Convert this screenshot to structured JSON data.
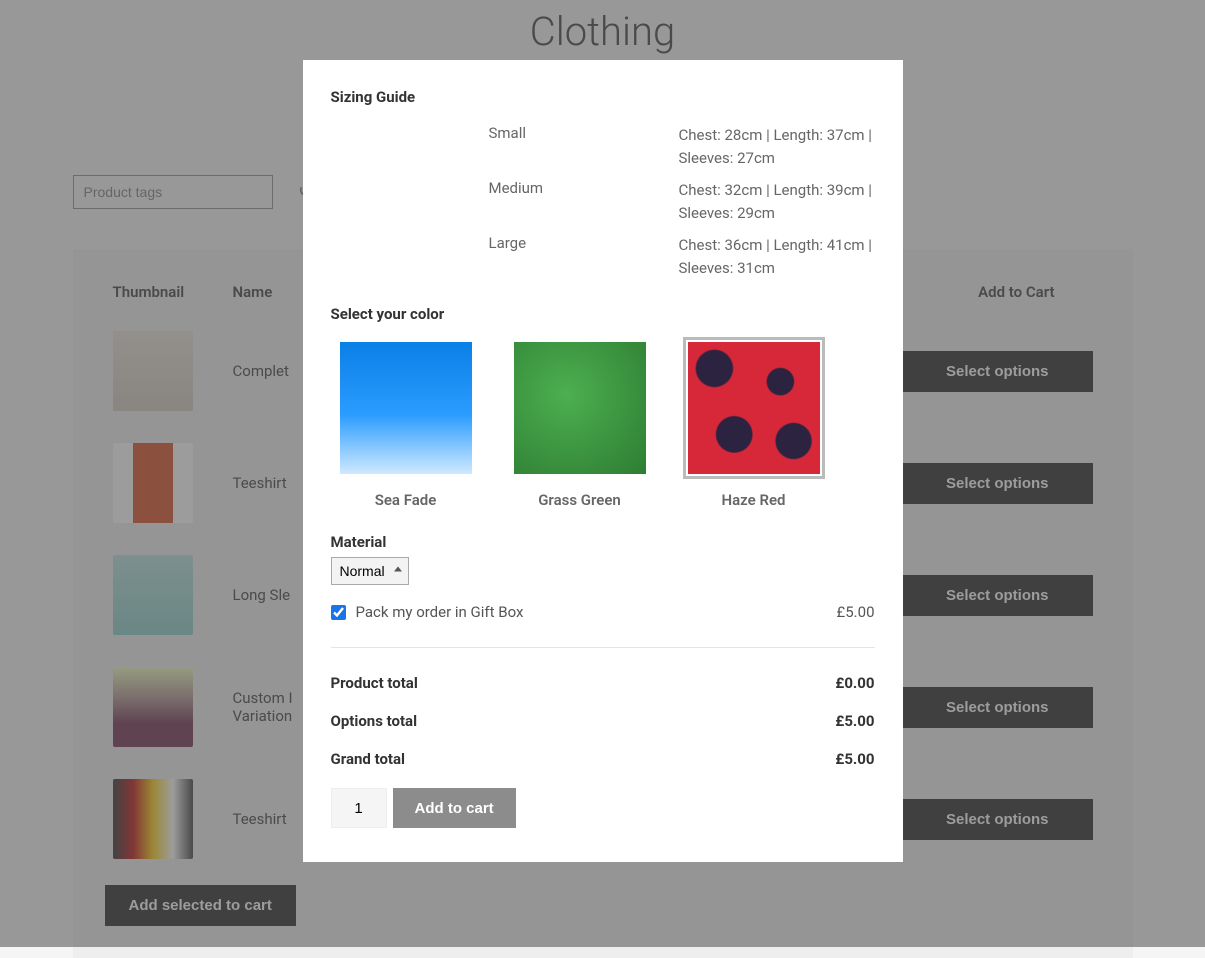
{
  "page_title": "Clothing",
  "filter_placeholder": "Product tags",
  "table": {
    "headers": {
      "thumbnail": "Thumbnail",
      "name": "Name",
      "add_to_cart": "Add to Cart"
    },
    "rows": [
      {
        "name": "Complet",
        "cta": "Select options"
      },
      {
        "name": "Teeshirt",
        "cta": "Select options"
      },
      {
        "name": "Long Sle",
        "cta": "Select options"
      },
      {
        "name": "Custom I\nVariation",
        "cta": "Select options"
      },
      {
        "name": "Teeshirt",
        "cta": "Select options"
      }
    ],
    "add_selected": "Add selected to cart"
  },
  "modal": {
    "sizing_guide_title": "Sizing Guide",
    "sizes": [
      {
        "label": "Small",
        "detail": "Chest: 28cm | Length: 37cm | Sleeves: 27cm"
      },
      {
        "label": "Medium",
        "detail": "Chest: 32cm | Length: 39cm | Sleeves: 29cm"
      },
      {
        "label": "Large",
        "detail": "Chest: 36cm | Length: 41cm | Sleeves: 31cm"
      }
    ],
    "color_label": "Select your color",
    "swatches": [
      {
        "name": "Sea Fade"
      },
      {
        "name": "Grass Green"
      },
      {
        "name": "Haze Red"
      }
    ],
    "selected_swatch": 2,
    "material_label": "Material",
    "material_selected": "Normal",
    "giftbox_label": "Pack my order in Gift Box",
    "giftbox_checked": true,
    "giftbox_price": "£5.00",
    "totals": {
      "product_total_label": "Product total",
      "product_total_value": "£0.00",
      "options_total_label": "Options total",
      "options_total_value": "£5.00",
      "grand_total_label": "Grand total",
      "grand_total_value": "£5.00"
    },
    "qty_value": "1",
    "add_to_cart": "Add to cart"
  }
}
